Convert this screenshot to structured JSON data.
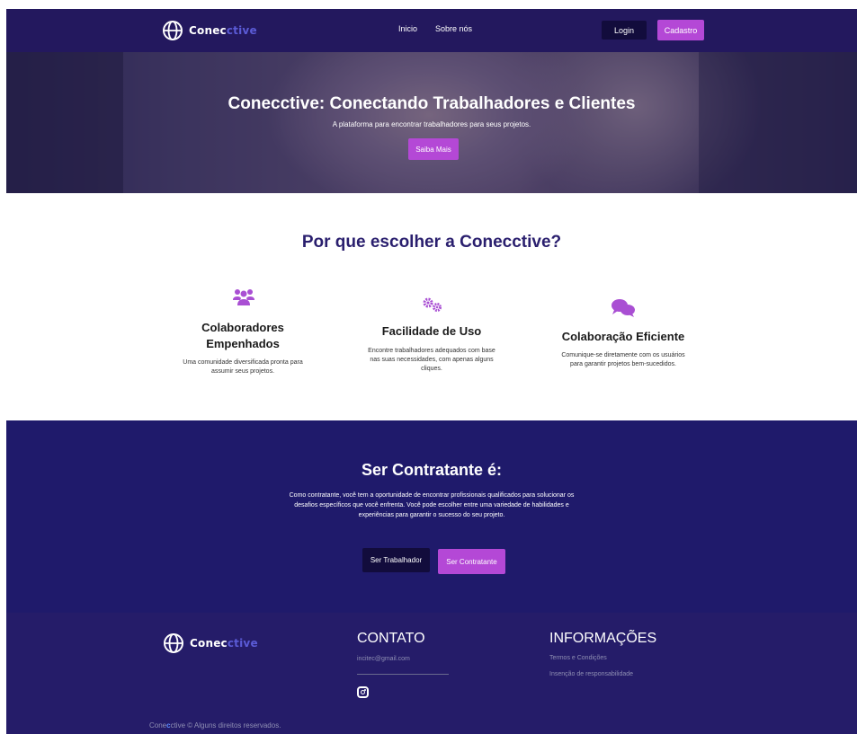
{
  "brand": {
    "name_prefix": "Conec",
    "name_suffix": "ctive"
  },
  "nav": {
    "links": [
      "Inicio",
      "Sobre nós"
    ],
    "login_label": "Login",
    "signup_label": "Cadastro"
  },
  "hero": {
    "title": "Conecctive: Conectando Trabalhadores e Clientes",
    "subtitle": "A plataforma para encontrar trabalhadores para seus projetos.",
    "cta_label": "Saiba Mais"
  },
  "why": {
    "title": "Por que escolher a Conecctive?",
    "features": [
      {
        "icon": "users-icon",
        "title_line1": "Colaboradores",
        "title_line2": "Empenhados",
        "desc_line1": "Uma comunidade diversificada pronta para",
        "desc_line2": "assumir seus projetos."
      },
      {
        "icon": "gears-icon",
        "title": "Facilidade de Uso",
        "desc_line1": "Encontre trabalhadores adequados com base",
        "desc_line2": "nas suas necessidades, com apenas alguns",
        "desc_line3": "cliques."
      },
      {
        "icon": "chat-icon",
        "title": "Colaboração Eficiente",
        "desc_line1": "Comunique-se diretamente com os usuários",
        "desc_line2": "para garantir projetos bem-sucedidos."
      }
    ]
  },
  "contratante": {
    "title": "Ser Contratante é:",
    "desc": "Como contratante, você tem a oportunidade de encontrar profissionais qualificados para solucionar os desafios específicos que você enfrenta. Você pode escolher entre uma variedade de habilidades e experiências para garantir o sucesso do seu projeto.",
    "worker_label": "Ser Trabalhador",
    "hirer_label": "Ser Contratante"
  },
  "footer": {
    "contact_heading": "CONTATO",
    "email": "incitec@gmail.com",
    "info_heading": "INFORMAÇÕES",
    "terms": "Termos e Condições",
    "disclaimer": "Insenção de responsabilidade",
    "copyright_prefix": "Cone",
    "copyright_hl": "c",
    "copyright_rest": "ctive © Alguns direitos reservados."
  },
  "colors": {
    "nav_bg": "#23185e",
    "accent_purple": "#b448d6",
    "dark_button": "#120c3c",
    "section_bg": "#1f1a6b",
    "footer_bg": "#251c69",
    "heading_purple": "#2a1f6e"
  }
}
